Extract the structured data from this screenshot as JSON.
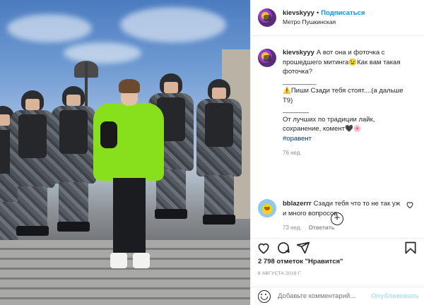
{
  "header": {
    "username": "kievskyyy",
    "separator": "•",
    "follow_label": "Подписаться",
    "location": "Метро Пушкинская"
  },
  "caption": {
    "username": "kievskyyy",
    "text": "А вот она и фоточка с прошедшего митинга😉Как вам такая фоточка?\n_________\n⚠️Пиши Сзади тебя стоят....(а дальше Т9)\n_______\nОт лучших по традиции лайк, сохранение, комент🖤🌸",
    "hashtag": "#оравент",
    "age": "76 нед."
  },
  "load_more_icon": "plus-circle-icon",
  "comments": [
    {
      "username": "bblazerrr",
      "text": "Сзади тебя что то не так уж и много вопросов",
      "age": "73 нед.",
      "reply_label": "Ответить"
    }
  ],
  "actions": {
    "icons": [
      "heart-icon",
      "comment-icon",
      "share-icon",
      "bookmark-icon"
    ]
  },
  "likes": "2 798 отметок \"Нравится\"",
  "date": "8 АВГУСТА 2019 Г.",
  "add_comment": {
    "placeholder": "Добавьте комментарий...",
    "publish_label": "Опубликовать"
  },
  "colors": {
    "follow_blue": "#0095f6",
    "hashtag": "#00376b",
    "muted": "#8e8e8e",
    "hoodie_green": "#88e01d"
  }
}
